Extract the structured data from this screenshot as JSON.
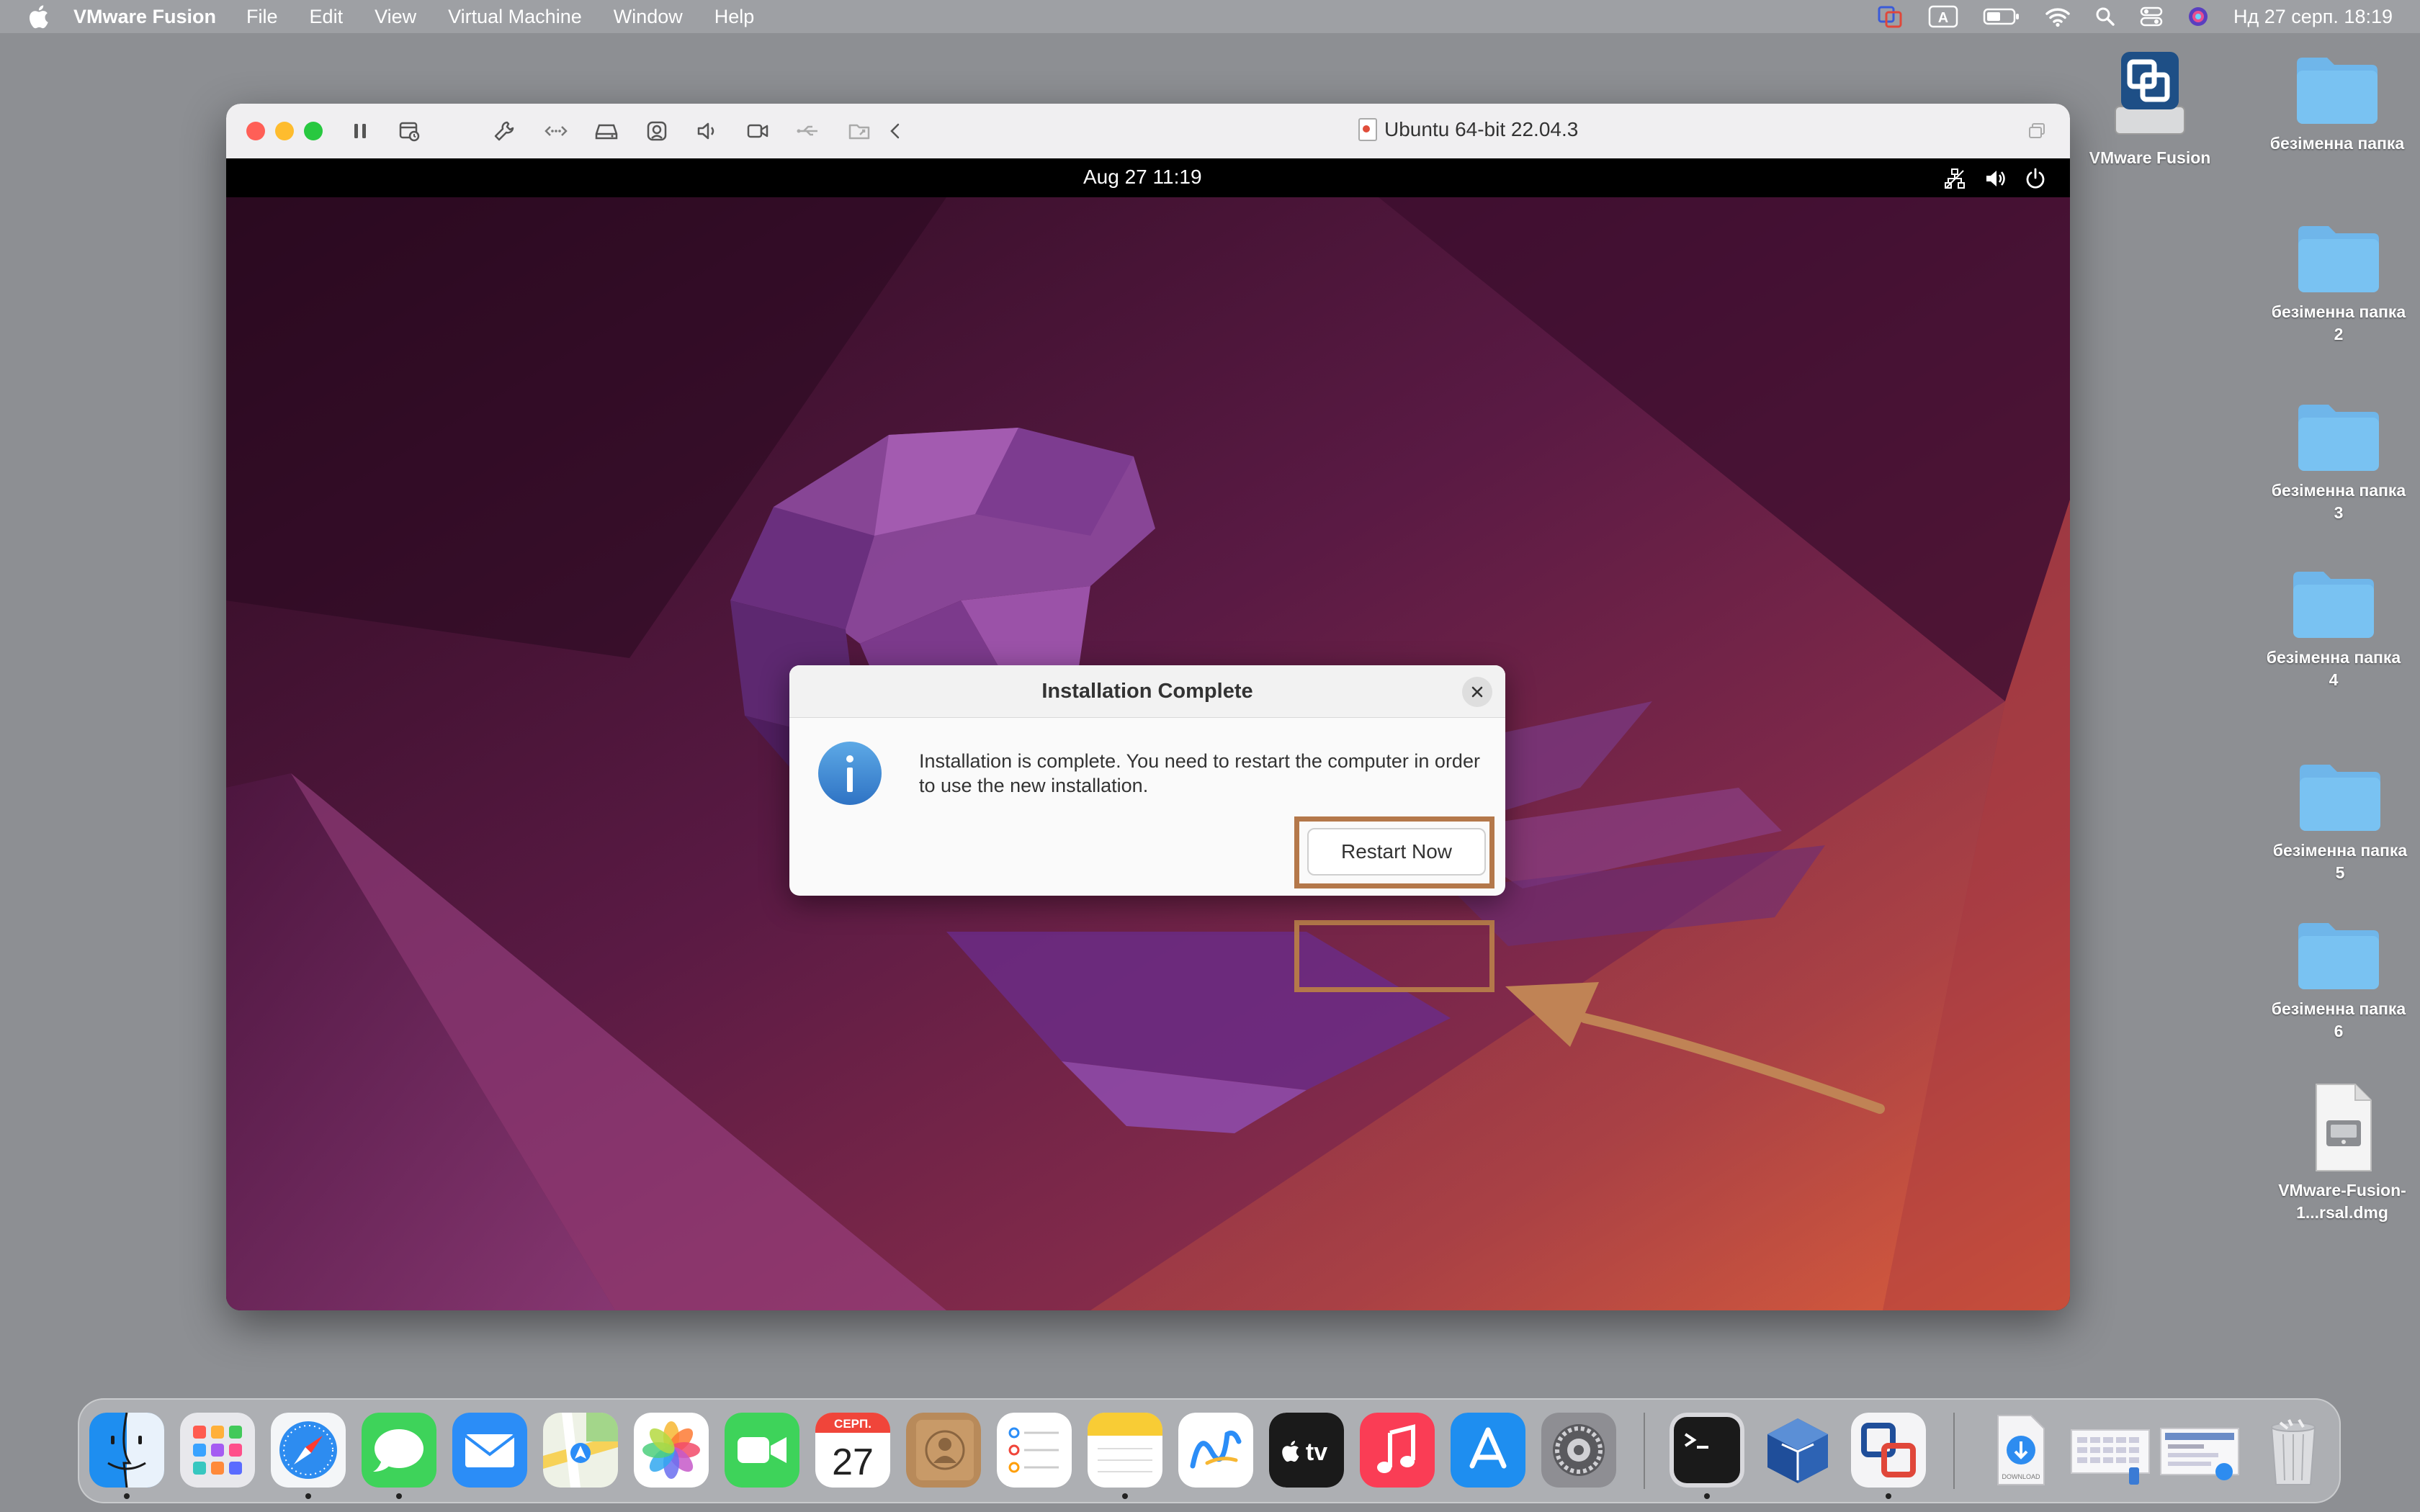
{
  "menubar": {
    "apple_icon": "apple-icon",
    "items": [
      "VMware Fusion",
      "File",
      "Edit",
      "View",
      "Virtual Machine",
      "Window",
      "Help"
    ],
    "keyboard_layout": "A",
    "clock": "Нд 27 серп.  18:19"
  },
  "desktop": {
    "icons": [
      {
        "label": "VMware Fusion",
        "type": "volume"
      },
      {
        "label": "безіменна папка",
        "type": "folder"
      },
      {
        "label": "безіменна папка 2",
        "type": "folder"
      },
      {
        "label": "безіменна папка 3",
        "type": "folder"
      },
      {
        "label": "безіменна папка 4",
        "type": "folder"
      },
      {
        "label": "безіменна папка 5",
        "type": "folder"
      },
      {
        "label": "безіменна папка 6",
        "type": "folder"
      },
      {
        "label": "VMware-Fusion-1...rsal.dmg",
        "type": "disk-image"
      }
    ]
  },
  "vm_window": {
    "title": "Ubuntu 64-bit 22.04.3",
    "toolbar_icons": [
      "pause-icon",
      "snapshot-icon",
      "settings-wrench-icon",
      "network-icon",
      "hard-disk-icon",
      "camera-device-icon",
      "sound-icon",
      "video-camera-icon",
      "usb-icon",
      "shared-folder-icon",
      "back-chevron-icon"
    ]
  },
  "guest": {
    "clock": "Aug 27  11:19",
    "tray_icons": [
      "network-wired-icon",
      "volume-icon",
      "power-icon"
    ]
  },
  "dialog": {
    "title": "Installation Complete",
    "message": "Installation is complete. You need to restart the computer in order to use the new installation.",
    "button": "Restart Now"
  },
  "dock": {
    "apps": [
      "Finder",
      "Launchpad",
      "Safari",
      "Messages",
      "Mail",
      "Maps",
      "Photos",
      "FaceTime",
      "Calendar",
      "Contacts",
      "Reminders",
      "Notes",
      "Freeform",
      "TV",
      "Music",
      "App Store",
      "System Settings",
      "Terminal",
      "VirtualBox",
      "VMware Fusion",
      "Downloads",
      "Screenshot",
      "Screenshot 2",
      "Trash"
    ],
    "calendar_month": "СЕРП.",
    "calendar_day": "27",
    "tv_label": "tv",
    "downloads_label": "DOWNLOAD"
  },
  "colors": {
    "highlight": "#b4784a",
    "wallpaper_dark": "#3a0f2a",
    "wallpaper_light": "#d0553a"
  }
}
